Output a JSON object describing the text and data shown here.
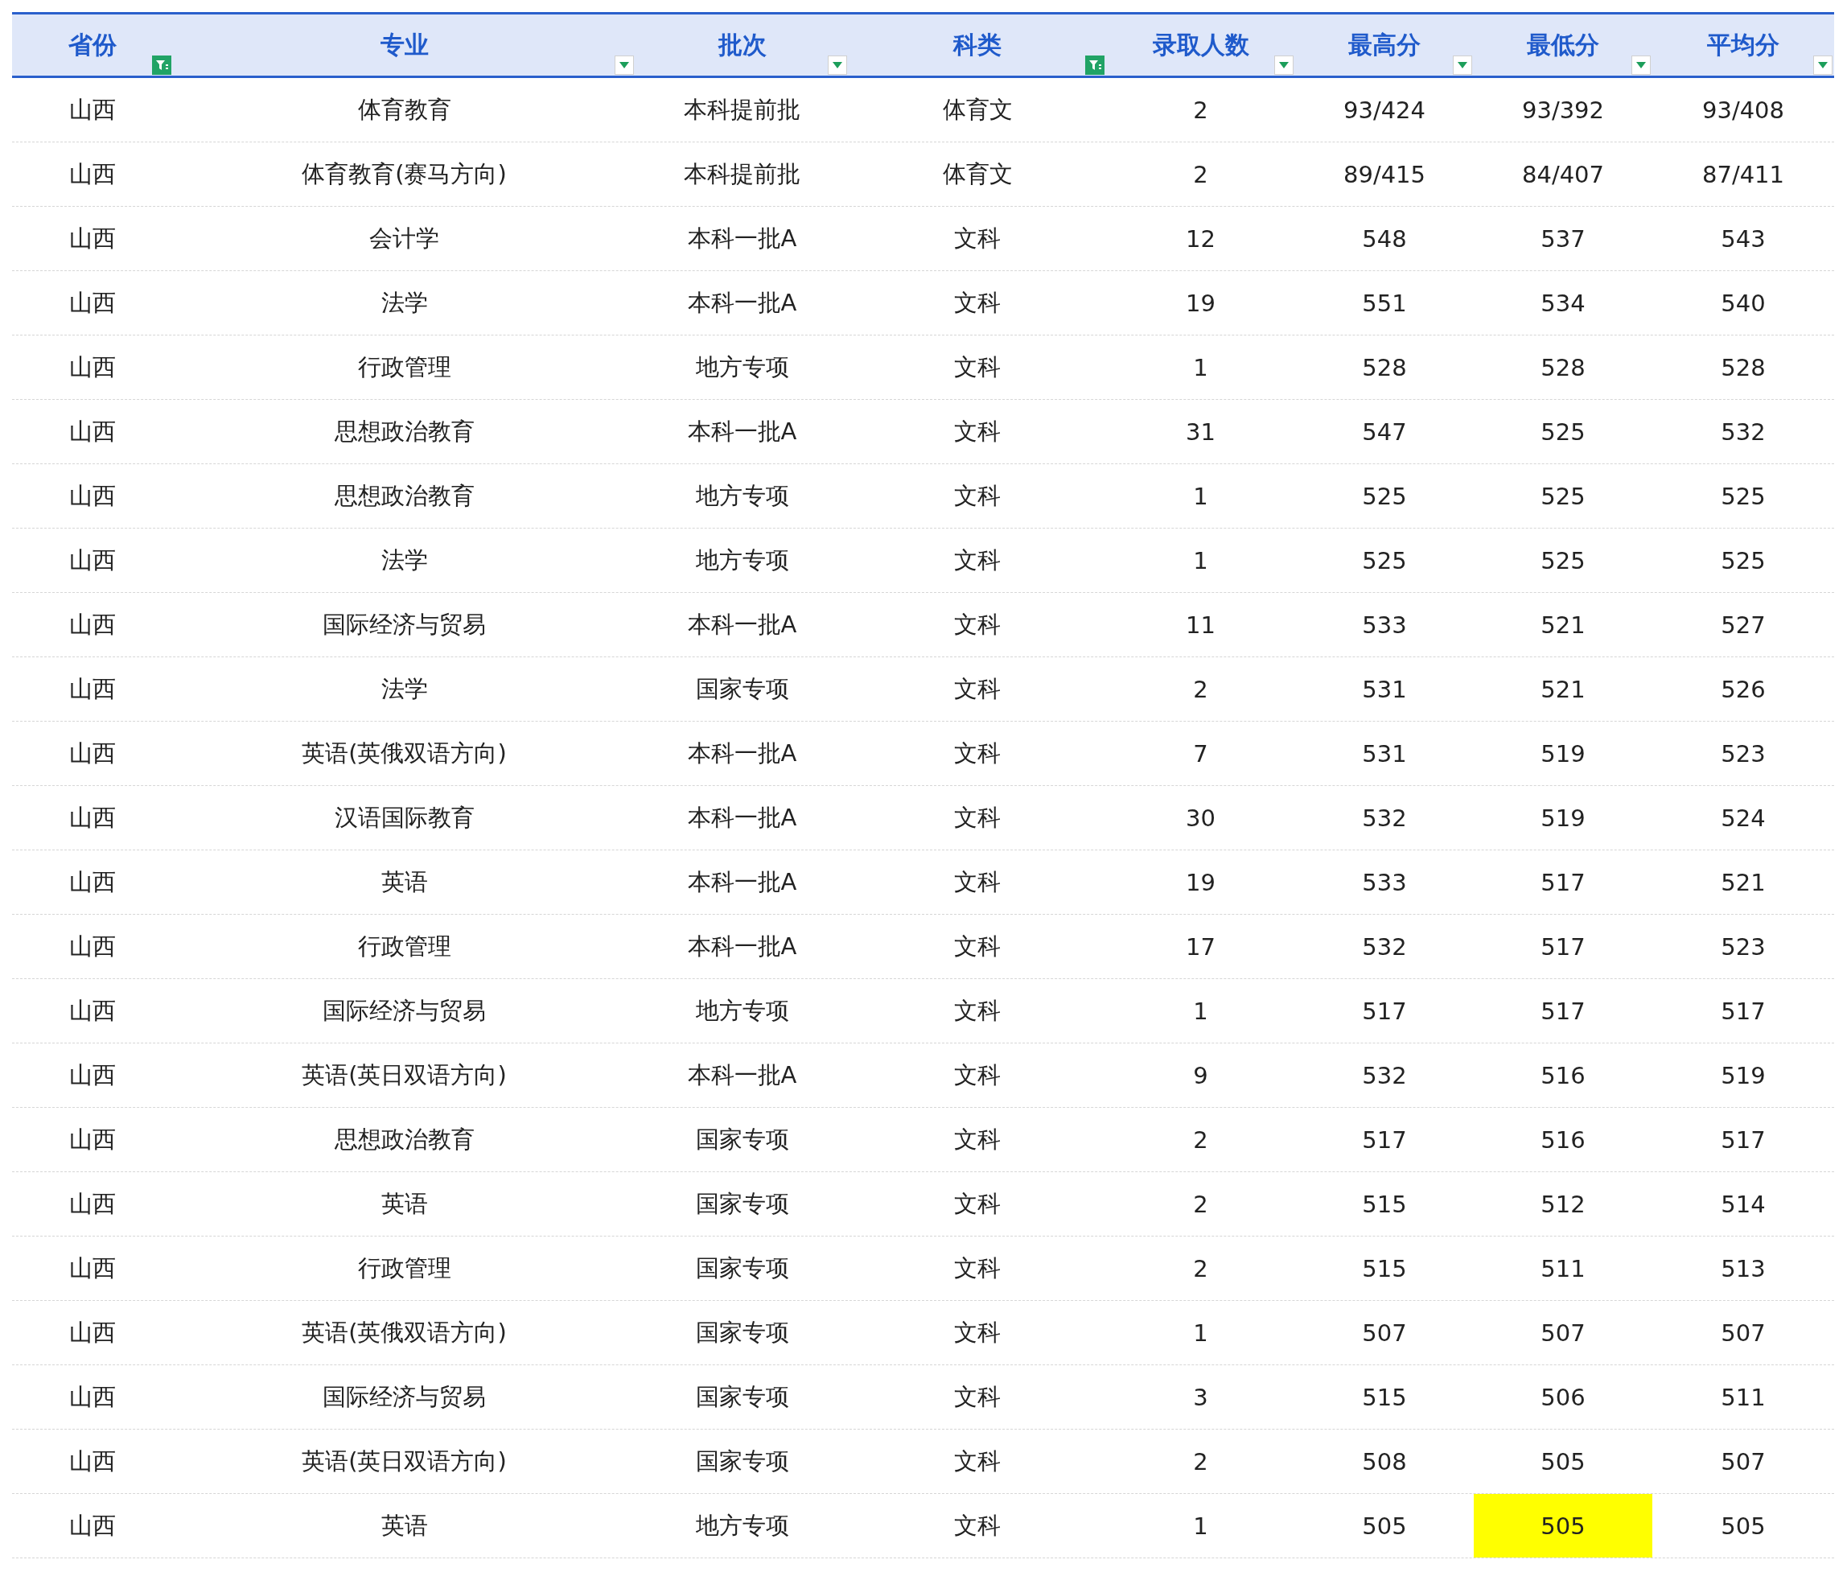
{
  "table": {
    "columns": [
      {
        "label": "省份",
        "filtered": true
      },
      {
        "label": "专业",
        "filtered": false
      },
      {
        "label": "批次",
        "filtered": false
      },
      {
        "label": "科类",
        "filtered": true
      },
      {
        "label": "录取人数",
        "filtered": false
      },
      {
        "label": "最高分",
        "filtered": false
      },
      {
        "label": "最低分",
        "filtered": false
      },
      {
        "label": "平均分",
        "filtered": false
      }
    ],
    "rows": [
      {
        "cells": [
          "山西",
          "体育教育",
          "本科提前批",
          "体育文",
          "2",
          "93/424",
          "93/392",
          "93/408"
        ],
        "highlighted": [
          false,
          false,
          false,
          false,
          false,
          false,
          false,
          false
        ]
      },
      {
        "cells": [
          "山西",
          "体育教育(赛马方向)",
          "本科提前批",
          "体育文",
          "2",
          "89/415",
          "84/407",
          "87/411"
        ],
        "highlighted": [
          false,
          false,
          false,
          false,
          false,
          false,
          false,
          false
        ]
      },
      {
        "cells": [
          "山西",
          "会计学",
          "本科一批A",
          "文科",
          "12",
          "548",
          "537",
          "543"
        ],
        "highlighted": [
          false,
          false,
          false,
          false,
          false,
          false,
          false,
          false
        ]
      },
      {
        "cells": [
          "山西",
          "法学",
          "本科一批A",
          "文科",
          "19",
          "551",
          "534",
          "540"
        ],
        "highlighted": [
          false,
          false,
          false,
          false,
          false,
          false,
          false,
          false
        ]
      },
      {
        "cells": [
          "山西",
          "行政管理",
          "地方专项",
          "文科",
          "1",
          "528",
          "528",
          "528"
        ],
        "highlighted": [
          false,
          false,
          false,
          false,
          false,
          false,
          false,
          false
        ]
      },
      {
        "cells": [
          "山西",
          "思想政治教育",
          "本科一批A",
          "文科",
          "31",
          "547",
          "525",
          "532"
        ],
        "highlighted": [
          false,
          false,
          false,
          false,
          false,
          false,
          false,
          false
        ]
      },
      {
        "cells": [
          "山西",
          "思想政治教育",
          "地方专项",
          "文科",
          "1",
          "525",
          "525",
          "525"
        ],
        "highlighted": [
          false,
          false,
          false,
          false,
          false,
          false,
          false,
          false
        ]
      },
      {
        "cells": [
          "山西",
          "法学",
          "地方专项",
          "文科",
          "1",
          "525",
          "525",
          "525"
        ],
        "highlighted": [
          false,
          false,
          false,
          false,
          false,
          false,
          false,
          false
        ]
      },
      {
        "cells": [
          "山西",
          "国际经济与贸易",
          "本科一批A",
          "文科",
          "11",
          "533",
          "521",
          "527"
        ],
        "highlighted": [
          false,
          false,
          false,
          false,
          false,
          false,
          false,
          false
        ]
      },
      {
        "cells": [
          "山西",
          "法学",
          "国家专项",
          "文科",
          "2",
          "531",
          "521",
          "526"
        ],
        "highlighted": [
          false,
          false,
          false,
          false,
          false,
          false,
          false,
          false
        ]
      },
      {
        "cells": [
          "山西",
          "英语(英俄双语方向)",
          "本科一批A",
          "文科",
          "7",
          "531",
          "519",
          "523"
        ],
        "highlighted": [
          false,
          false,
          false,
          false,
          false,
          false,
          false,
          false
        ]
      },
      {
        "cells": [
          "山西",
          "汉语国际教育",
          "本科一批A",
          "文科",
          "30",
          "532",
          "519",
          "524"
        ],
        "highlighted": [
          false,
          false,
          false,
          false,
          false,
          false,
          false,
          false
        ]
      },
      {
        "cells": [
          "山西",
          "英语",
          "本科一批A",
          "文科",
          "19",
          "533",
          "517",
          "521"
        ],
        "highlighted": [
          false,
          false,
          false,
          false,
          false,
          false,
          false,
          false
        ]
      },
      {
        "cells": [
          "山西",
          "行政管理",
          "本科一批A",
          "文科",
          "17",
          "532",
          "517",
          "523"
        ],
        "highlighted": [
          false,
          false,
          false,
          false,
          false,
          false,
          false,
          false
        ]
      },
      {
        "cells": [
          "山西",
          "国际经济与贸易",
          "地方专项",
          "文科",
          "1",
          "517",
          "517",
          "517"
        ],
        "highlighted": [
          false,
          false,
          false,
          false,
          false,
          false,
          false,
          false
        ]
      },
      {
        "cells": [
          "山西",
          "英语(英日双语方向)",
          "本科一批A",
          "文科",
          "9",
          "532",
          "516",
          "519"
        ],
        "highlighted": [
          false,
          false,
          false,
          false,
          false,
          false,
          false,
          false
        ]
      },
      {
        "cells": [
          "山西",
          "思想政治教育",
          "国家专项",
          "文科",
          "2",
          "517",
          "516",
          "517"
        ],
        "highlighted": [
          false,
          false,
          false,
          false,
          false,
          false,
          false,
          false
        ]
      },
      {
        "cells": [
          "山西",
          "英语",
          "国家专项",
          "文科",
          "2",
          "515",
          "512",
          "514"
        ],
        "highlighted": [
          false,
          false,
          false,
          false,
          false,
          false,
          false,
          false
        ]
      },
      {
        "cells": [
          "山西",
          "行政管理",
          "国家专项",
          "文科",
          "2",
          "515",
          "511",
          "513"
        ],
        "highlighted": [
          false,
          false,
          false,
          false,
          false,
          false,
          false,
          false
        ]
      },
      {
        "cells": [
          "山西",
          "英语(英俄双语方向)",
          "国家专项",
          "文科",
          "1",
          "507",
          "507",
          "507"
        ],
        "highlighted": [
          false,
          false,
          false,
          false,
          false,
          false,
          false,
          false
        ]
      },
      {
        "cells": [
          "山西",
          "国际经济与贸易",
          "国家专项",
          "文科",
          "3",
          "515",
          "506",
          "511"
        ],
        "highlighted": [
          false,
          false,
          false,
          false,
          false,
          false,
          false,
          false
        ]
      },
      {
        "cells": [
          "山西",
          "英语(英日双语方向)",
          "国家专项",
          "文科",
          "2",
          "508",
          "505",
          "507"
        ],
        "highlighted": [
          false,
          false,
          false,
          false,
          false,
          false,
          false,
          false
        ]
      },
      {
        "cells": [
          "山西",
          "英语",
          "地方专项",
          "文科",
          "1",
          "505",
          "505",
          "505"
        ],
        "highlighted": [
          false,
          false,
          false,
          false,
          false,
          false,
          true,
          false
        ]
      }
    ]
  }
}
